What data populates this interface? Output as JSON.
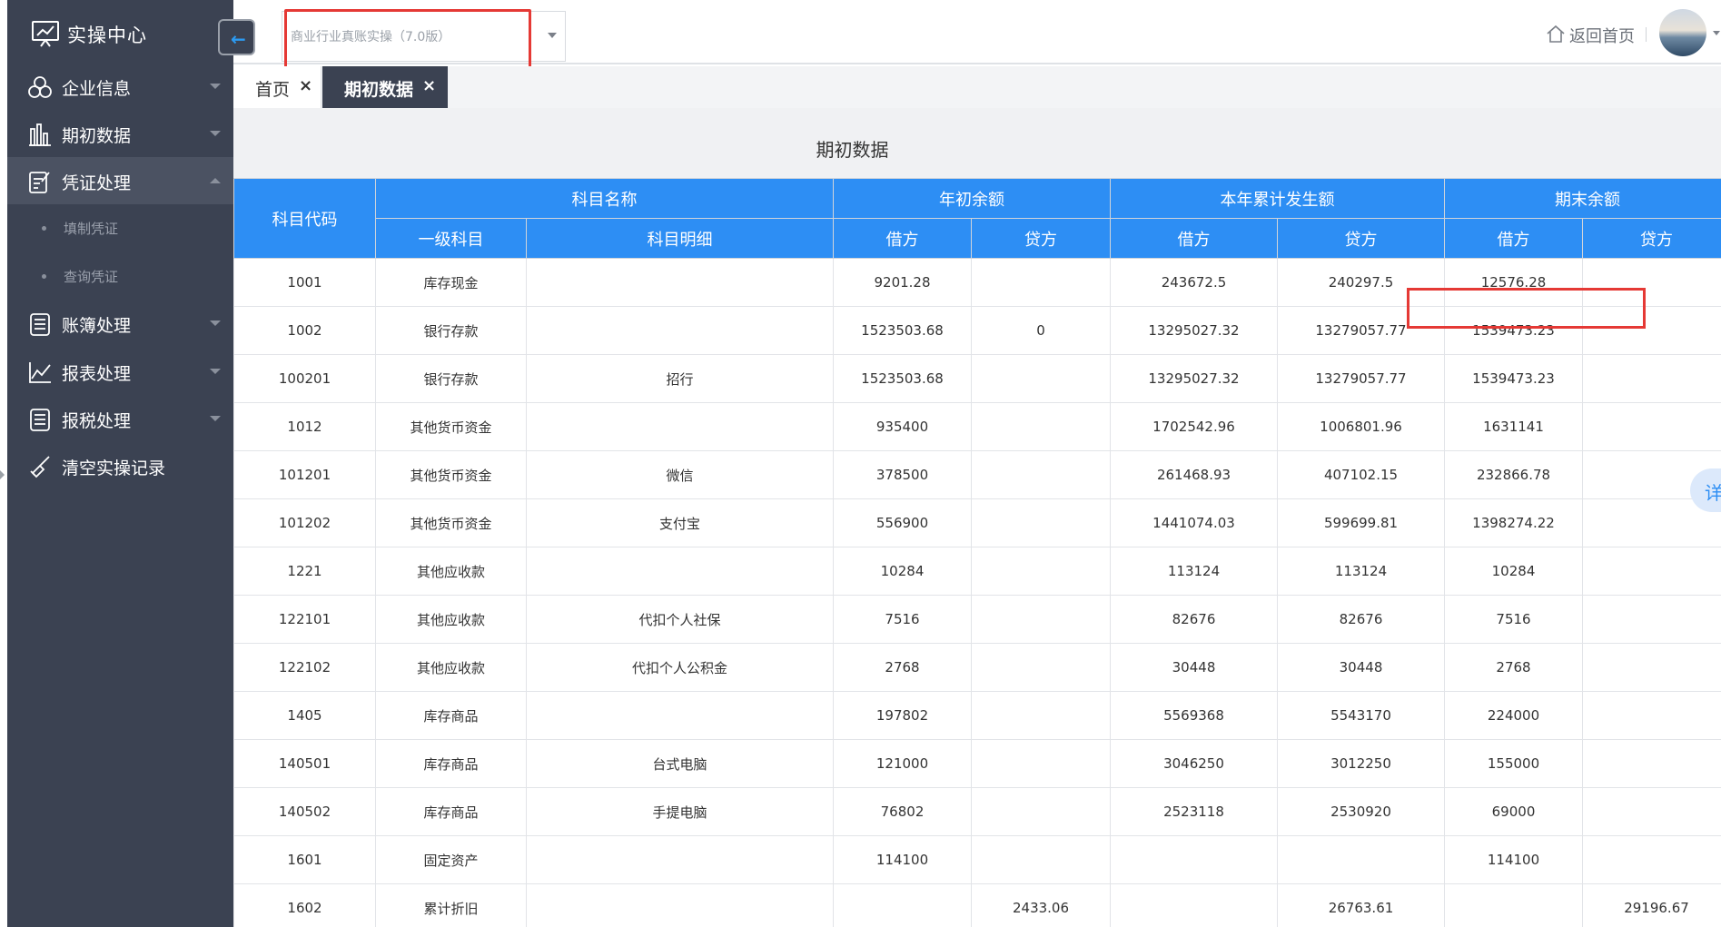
{
  "sidebar": {
    "brand": "实操中心",
    "menu": [
      {
        "label": "企业信息",
        "icon": "building-icon"
      },
      {
        "label": "期初数据",
        "icon": "bar-chart-icon"
      },
      {
        "label": "凭证处理",
        "icon": "document-edit-icon"
      },
      {
        "label": "账簿处理",
        "icon": "ledger-icon"
      },
      {
        "label": "报表处理",
        "icon": "line-chart-icon"
      },
      {
        "label": "报税处理",
        "icon": "tax-icon"
      },
      {
        "label": "清空实操记录",
        "icon": "broom-icon"
      }
    ],
    "submenu": [
      "填制凭证",
      "查询凭证"
    ]
  },
  "topbar": {
    "select_value": "商业行业真账实操（7.0版）",
    "home_label": "返回首页"
  },
  "tabs": [
    {
      "label": "首页",
      "close": "×"
    },
    {
      "label": "期初数据",
      "close": "×"
    }
  ],
  "page": {
    "title": "期初数据"
  },
  "table": {
    "headers": {
      "code": "科目代码",
      "name": "科目名称",
      "opening": "年初余额",
      "ytd": "本年累计发生额",
      "closing": "期末余额",
      "level1": "一级科目",
      "detail": "科目明细",
      "debit": "借方",
      "credit": "贷方"
    },
    "rows": [
      [
        "1001",
        "库存现金",
        "",
        "9201.28",
        "",
        "243672.5",
        "240297.5",
        "12576.28",
        ""
      ],
      [
        "1002",
        "银行存款",
        "",
        "1523503.68",
        "0",
        "13295027.32",
        "13279057.77",
        "1539473.23",
        ""
      ],
      [
        "100201",
        "银行存款",
        "招行",
        "1523503.68",
        "",
        "13295027.32",
        "13279057.77",
        "1539473.23",
        ""
      ],
      [
        "1012",
        "其他货币资金",
        "",
        "935400",
        "",
        "1702542.96",
        "1006801.96",
        "1631141",
        ""
      ],
      [
        "101201",
        "其他货币资金",
        "微信",
        "378500",
        "",
        "261468.93",
        "407102.15",
        "232866.78",
        ""
      ],
      [
        "101202",
        "其他货币资金",
        "支付宝",
        "556900",
        "",
        "1441074.03",
        "599699.81",
        "1398274.22",
        ""
      ],
      [
        "1221",
        "其他应收款",
        "",
        "10284",
        "",
        "113124",
        "113124",
        "10284",
        ""
      ],
      [
        "122101",
        "其他应收款",
        "代扣个人社保",
        "7516",
        "",
        "82676",
        "82676",
        "7516",
        ""
      ],
      [
        "122102",
        "其他应收款",
        "代扣个人公积金",
        "2768",
        "",
        "30448",
        "30448",
        "2768",
        ""
      ],
      [
        "1405",
        "库存商品",
        "",
        "197802",
        "",
        "5569368",
        "5543170",
        "224000",
        ""
      ],
      [
        "140501",
        "库存商品",
        "台式电脑",
        "121000",
        "",
        "3046250",
        "3012250",
        "155000",
        ""
      ],
      [
        "140502",
        "库存商品",
        "手提电脑",
        "76802",
        "",
        "2523118",
        "2530920",
        "69000",
        ""
      ],
      [
        "1601",
        "固定资产",
        "",
        "114100",
        "",
        "",
        "",
        "114100",
        ""
      ],
      [
        "1602",
        "累计折旧",
        "",
        "",
        "2433.06",
        "",
        "26763.61",
        "",
        "29196.67"
      ]
    ]
  },
  "float_button": "详"
}
